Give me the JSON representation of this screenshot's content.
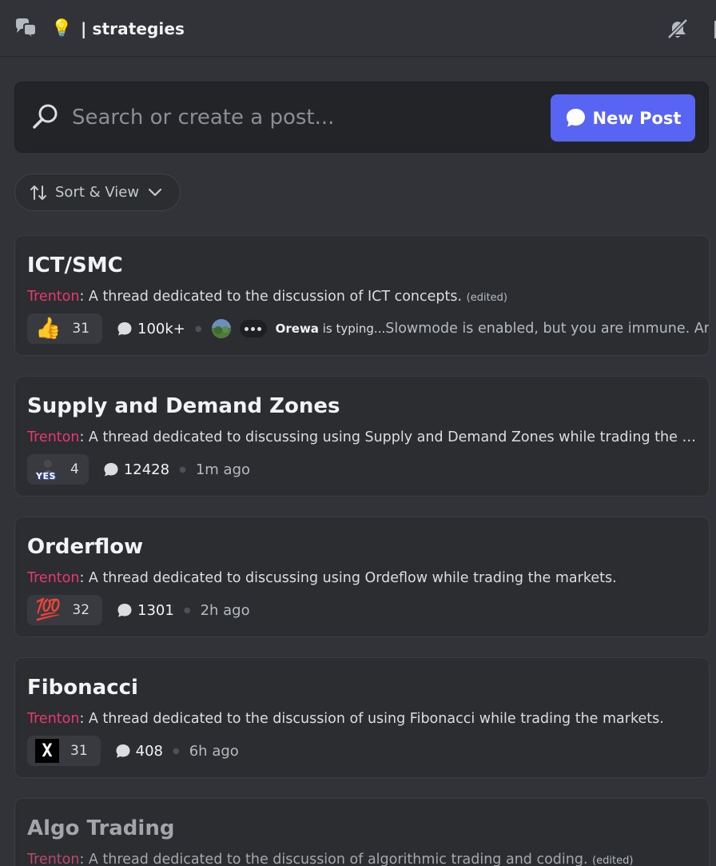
{
  "header": {
    "channel_icon": "forum-channel-icon",
    "emoji": "💡",
    "channel_name": "| strategies",
    "mute_icon": "bell-slash-icon"
  },
  "search": {
    "placeholder": "Search or create a post...",
    "new_post_label": "New Post"
  },
  "sort": {
    "label": "Sort & View"
  },
  "colors": {
    "background": "#313338",
    "card": "#2b2d31",
    "accent": "#5865f2",
    "author": "#e8386e"
  },
  "posts": [
    {
      "title": "ICT/SMC",
      "author": "Trenton",
      "snippet": ": A thread dedicated to the discussion of ICT concepts.",
      "edited": "(edited)",
      "reaction_emoji": "👍",
      "reaction_count": "31",
      "message_count": "100k+",
      "typing_user": "Orewa",
      "typing_suffix": " is typing...",
      "typing_message": "Slowmode is enabled, but you are immune. Am"
    },
    {
      "title": "Supply and Demand Zones",
      "author": "Trenton",
      "snippet": ": A thread dedicated to discussing using Supply and Demand Zones while trading the markets.",
      "reaction_emoji": "YES",
      "reaction_count": "4",
      "message_count": "12428",
      "time": "1m ago"
    },
    {
      "title": "Orderflow",
      "author": "Trenton",
      "snippet": ": A thread dedicated to discussing using Ordeflow while trading the markets.",
      "reaction_emoji": "💯",
      "reaction_count": "32",
      "message_count": "1301",
      "time": "2h ago"
    },
    {
      "title": "Fibonacci",
      "author": "Trenton",
      "snippet": ": A thread dedicated to the discussion of using Fibonacci while trading the markets.",
      "reaction_emoji": "X",
      "reaction_count": "31",
      "message_count": "408",
      "time": "6h ago"
    },
    {
      "title": "Algo Trading",
      "author": "Trenton",
      "snippet": ": A thread dedicated to the discussion of algorithmic trading and coding.",
      "edited": "(edited)"
    }
  ]
}
